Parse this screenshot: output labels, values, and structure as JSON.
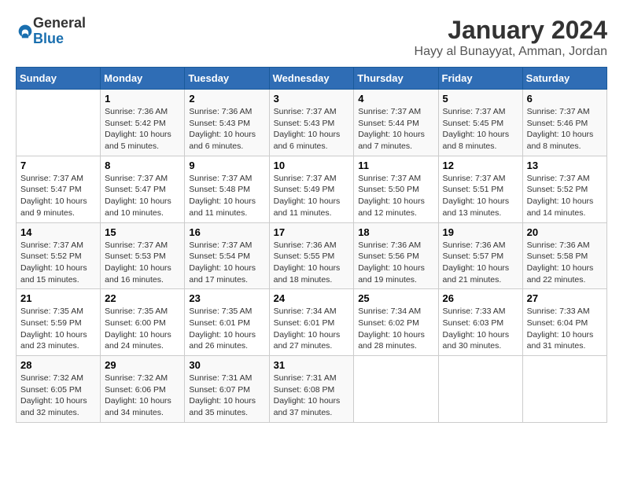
{
  "logo": {
    "general": "General",
    "blue": "Blue"
  },
  "header": {
    "month_year": "January 2024",
    "location": "Hayy al Bunayyat, Amman, Jordan"
  },
  "days_of_week": [
    "Sunday",
    "Monday",
    "Tuesday",
    "Wednesday",
    "Thursday",
    "Friday",
    "Saturday"
  ],
  "weeks": [
    [
      {
        "day": "",
        "sunrise": "",
        "sunset": "",
        "daylight": ""
      },
      {
        "day": "1",
        "sunrise": "Sunrise: 7:36 AM",
        "sunset": "Sunset: 5:42 PM",
        "daylight": "Daylight: 10 hours and 5 minutes."
      },
      {
        "day": "2",
        "sunrise": "Sunrise: 7:36 AM",
        "sunset": "Sunset: 5:43 PM",
        "daylight": "Daylight: 10 hours and 6 minutes."
      },
      {
        "day": "3",
        "sunrise": "Sunrise: 7:37 AM",
        "sunset": "Sunset: 5:43 PM",
        "daylight": "Daylight: 10 hours and 6 minutes."
      },
      {
        "day": "4",
        "sunrise": "Sunrise: 7:37 AM",
        "sunset": "Sunset: 5:44 PM",
        "daylight": "Daylight: 10 hours and 7 minutes."
      },
      {
        "day": "5",
        "sunrise": "Sunrise: 7:37 AM",
        "sunset": "Sunset: 5:45 PM",
        "daylight": "Daylight: 10 hours and 8 minutes."
      },
      {
        "day": "6",
        "sunrise": "Sunrise: 7:37 AM",
        "sunset": "Sunset: 5:46 PM",
        "daylight": "Daylight: 10 hours and 8 minutes."
      }
    ],
    [
      {
        "day": "7",
        "sunrise": "Sunrise: 7:37 AM",
        "sunset": "Sunset: 5:47 PM",
        "daylight": "Daylight: 10 hours and 9 minutes."
      },
      {
        "day": "8",
        "sunrise": "Sunrise: 7:37 AM",
        "sunset": "Sunset: 5:47 PM",
        "daylight": "Daylight: 10 hours and 10 minutes."
      },
      {
        "day": "9",
        "sunrise": "Sunrise: 7:37 AM",
        "sunset": "Sunset: 5:48 PM",
        "daylight": "Daylight: 10 hours and 11 minutes."
      },
      {
        "day": "10",
        "sunrise": "Sunrise: 7:37 AM",
        "sunset": "Sunset: 5:49 PM",
        "daylight": "Daylight: 10 hours and 11 minutes."
      },
      {
        "day": "11",
        "sunrise": "Sunrise: 7:37 AM",
        "sunset": "Sunset: 5:50 PM",
        "daylight": "Daylight: 10 hours and 12 minutes."
      },
      {
        "day": "12",
        "sunrise": "Sunrise: 7:37 AM",
        "sunset": "Sunset: 5:51 PM",
        "daylight": "Daylight: 10 hours and 13 minutes."
      },
      {
        "day": "13",
        "sunrise": "Sunrise: 7:37 AM",
        "sunset": "Sunset: 5:52 PM",
        "daylight": "Daylight: 10 hours and 14 minutes."
      }
    ],
    [
      {
        "day": "14",
        "sunrise": "Sunrise: 7:37 AM",
        "sunset": "Sunset: 5:52 PM",
        "daylight": "Daylight: 10 hours and 15 minutes."
      },
      {
        "day": "15",
        "sunrise": "Sunrise: 7:37 AM",
        "sunset": "Sunset: 5:53 PM",
        "daylight": "Daylight: 10 hours and 16 minutes."
      },
      {
        "day": "16",
        "sunrise": "Sunrise: 7:37 AM",
        "sunset": "Sunset: 5:54 PM",
        "daylight": "Daylight: 10 hours and 17 minutes."
      },
      {
        "day": "17",
        "sunrise": "Sunrise: 7:36 AM",
        "sunset": "Sunset: 5:55 PM",
        "daylight": "Daylight: 10 hours and 18 minutes."
      },
      {
        "day": "18",
        "sunrise": "Sunrise: 7:36 AM",
        "sunset": "Sunset: 5:56 PM",
        "daylight": "Daylight: 10 hours and 19 minutes."
      },
      {
        "day": "19",
        "sunrise": "Sunrise: 7:36 AM",
        "sunset": "Sunset: 5:57 PM",
        "daylight": "Daylight: 10 hours and 21 minutes."
      },
      {
        "day": "20",
        "sunrise": "Sunrise: 7:36 AM",
        "sunset": "Sunset: 5:58 PM",
        "daylight": "Daylight: 10 hours and 22 minutes."
      }
    ],
    [
      {
        "day": "21",
        "sunrise": "Sunrise: 7:35 AM",
        "sunset": "Sunset: 5:59 PM",
        "daylight": "Daylight: 10 hours and 23 minutes."
      },
      {
        "day": "22",
        "sunrise": "Sunrise: 7:35 AM",
        "sunset": "Sunset: 6:00 PM",
        "daylight": "Daylight: 10 hours and 24 minutes."
      },
      {
        "day": "23",
        "sunrise": "Sunrise: 7:35 AM",
        "sunset": "Sunset: 6:01 PM",
        "daylight": "Daylight: 10 hours and 26 minutes."
      },
      {
        "day": "24",
        "sunrise": "Sunrise: 7:34 AM",
        "sunset": "Sunset: 6:01 PM",
        "daylight": "Daylight: 10 hours and 27 minutes."
      },
      {
        "day": "25",
        "sunrise": "Sunrise: 7:34 AM",
        "sunset": "Sunset: 6:02 PM",
        "daylight": "Daylight: 10 hours and 28 minutes."
      },
      {
        "day": "26",
        "sunrise": "Sunrise: 7:33 AM",
        "sunset": "Sunset: 6:03 PM",
        "daylight": "Daylight: 10 hours and 30 minutes."
      },
      {
        "day": "27",
        "sunrise": "Sunrise: 7:33 AM",
        "sunset": "Sunset: 6:04 PM",
        "daylight": "Daylight: 10 hours and 31 minutes."
      }
    ],
    [
      {
        "day": "28",
        "sunrise": "Sunrise: 7:32 AM",
        "sunset": "Sunset: 6:05 PM",
        "daylight": "Daylight: 10 hours and 32 minutes."
      },
      {
        "day": "29",
        "sunrise": "Sunrise: 7:32 AM",
        "sunset": "Sunset: 6:06 PM",
        "daylight": "Daylight: 10 hours and 34 minutes."
      },
      {
        "day": "30",
        "sunrise": "Sunrise: 7:31 AM",
        "sunset": "Sunset: 6:07 PM",
        "daylight": "Daylight: 10 hours and 35 minutes."
      },
      {
        "day": "31",
        "sunrise": "Sunrise: 7:31 AM",
        "sunset": "Sunset: 6:08 PM",
        "daylight": "Daylight: 10 hours and 37 minutes."
      },
      {
        "day": "",
        "sunrise": "",
        "sunset": "",
        "daylight": ""
      },
      {
        "day": "",
        "sunrise": "",
        "sunset": "",
        "daylight": ""
      },
      {
        "day": "",
        "sunrise": "",
        "sunset": "",
        "daylight": ""
      }
    ]
  ]
}
